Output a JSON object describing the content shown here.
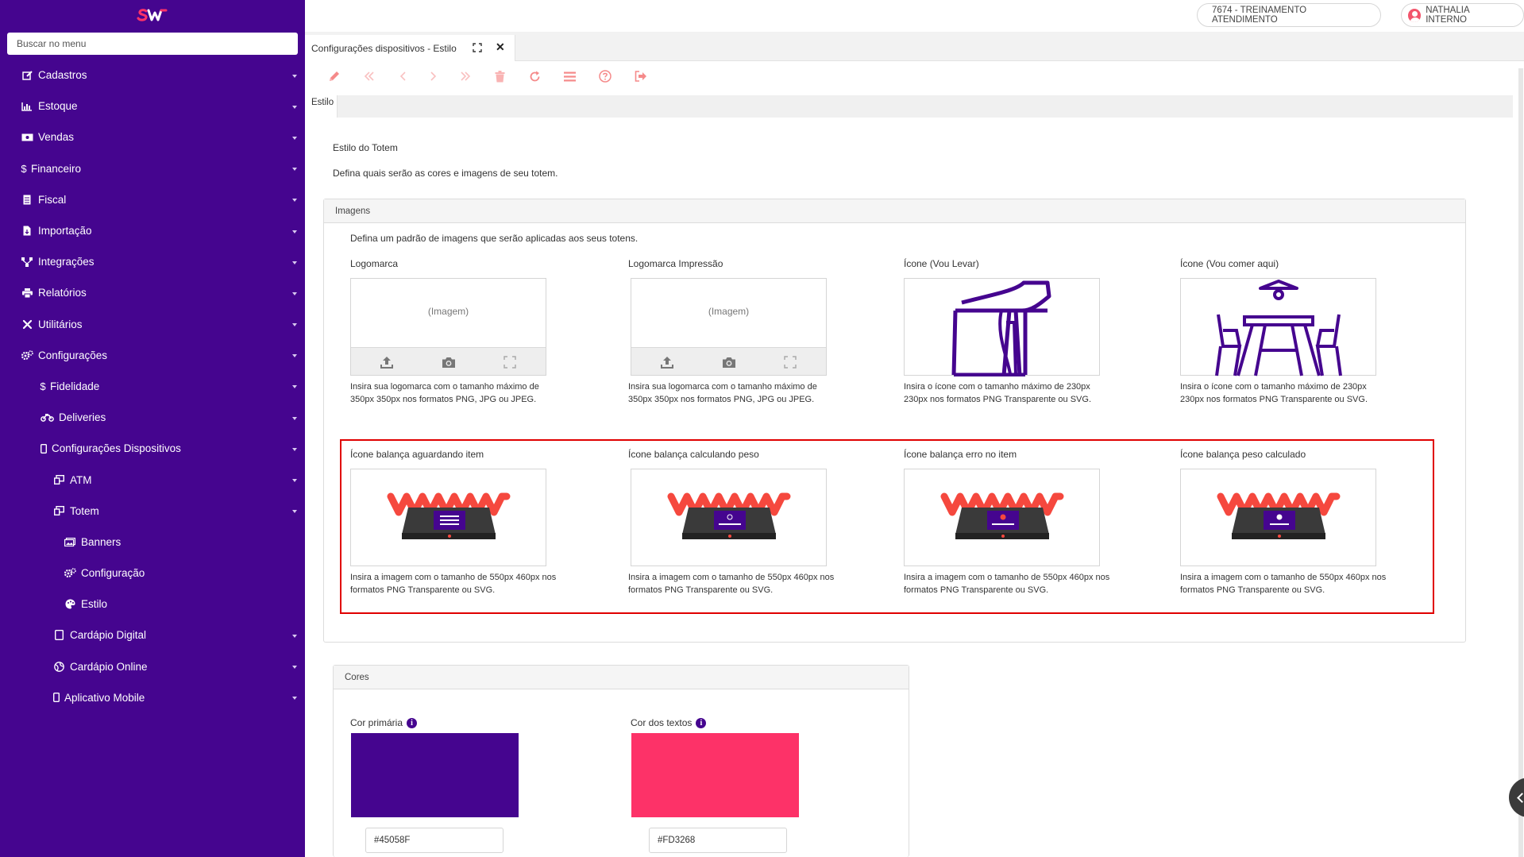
{
  "app": {
    "logo": "SW"
  },
  "sidebar": {
    "search_placeholder": "Buscar no menu",
    "items": [
      {
        "label": "Cadastros",
        "icon": "edit-icon"
      },
      {
        "label": "Estoque",
        "icon": "chart-icon"
      },
      {
        "label": "Vendas",
        "icon": "money-icon"
      },
      {
        "label": "Financeiro",
        "icon": "dollar-icon"
      },
      {
        "label": "Fiscal",
        "icon": "document-icon"
      },
      {
        "label": "Importação",
        "icon": "file-import-icon"
      },
      {
        "label": "Integrações",
        "icon": "network-icon"
      },
      {
        "label": "Relatórios",
        "icon": "print-icon"
      },
      {
        "label": "Utilitários",
        "icon": "tools-icon"
      },
      {
        "label": "Configurações",
        "icon": "cogs-icon"
      },
      {
        "label": "Fidelidade",
        "icon": "dollar-icon"
      },
      {
        "label": "Deliveries",
        "icon": "motorcycle-icon"
      },
      {
        "label": "Configurações Dispositivos",
        "icon": "mobile-icon"
      },
      {
        "label": "ATM",
        "icon": "desktop-icon"
      },
      {
        "label": "Totem",
        "icon": "desktop-icon"
      },
      {
        "label": "Banners",
        "icon": "images-icon"
      },
      {
        "label": "Configuração",
        "icon": "cogs-icon"
      },
      {
        "label": "Estilo",
        "icon": "palette-icon"
      },
      {
        "label": "Cardápio Digital",
        "icon": "tablet-icon"
      },
      {
        "label": "Cardápio Online",
        "icon": "globe-icon"
      },
      {
        "label": "Aplicativo Mobile",
        "icon": "mobile-icon"
      }
    ]
  },
  "header": {
    "company": "7674 - TREINAMENTO ATENDIMENTO",
    "user": "NATHALIA INTERNO"
  },
  "tab": {
    "label": "Configurações dispositivos - Estilo",
    "close": "✕"
  },
  "inner_tab": {
    "label": "Estilo"
  },
  "page": {
    "title": "Estilo do Totem",
    "description": "Defina quais serão as cores e imagens de seu totem."
  },
  "images_panel": {
    "title": "Imagens",
    "description": "Defina um padrão de imagens que serão aplicadas aos seus totens.",
    "placeholder": "(Imagem)",
    "fields": [
      {
        "label": "Logomarca",
        "help1": "Insira sua logomarca com o tamanho máximo de",
        "help2": "350px 350px nos formatos PNG, JPG ou JPEG."
      },
      {
        "label": "Logomarca Impressão",
        "help1": "Insira sua logomarca com o tamanho máximo de",
        "help2": "350px 350px nos formatos PNG, JPG ou JPEG."
      },
      {
        "label": "Ícone (Vou Levar)",
        "help1": "Insira o ícone com o tamanho máximo de 230px",
        "help2": "230px nos formatos PNG Transparente ou SVG."
      },
      {
        "label": "Ícone (Vou comer aqui)",
        "help1": "Insira o ícone com o tamanho máximo de 230px",
        "help2": "230px nos formatos PNG Transparente ou SVG."
      },
      {
        "label": "Ícone balança aguardando item",
        "help1": "Insira a imagem com o tamanho de 550px 460px nos",
        "help2": "formatos PNG Transparente ou SVG."
      },
      {
        "label": "Ícone balança calculando peso",
        "help1": "Insira a imagem com o tamanho de 550px 460px nos",
        "help2": "formatos PNG Transparente ou SVG."
      },
      {
        "label": "Ícone balança erro no item",
        "help1": "Insira a imagem com o tamanho de 550px 460px nos",
        "help2": "formatos PNG Transparente ou SVG."
      },
      {
        "label": "Ícone balança peso calculado",
        "help1": "Insira a imagem com o tamanho de 550px 460px nos",
        "help2": "formatos PNG Transparente ou SVG."
      }
    ]
  },
  "colors_panel": {
    "title": "Cores",
    "primary": {
      "label": "Cor primária",
      "value": "#45058F"
    },
    "text": {
      "label": "Cor dos textos",
      "value": "#FD3268"
    }
  },
  "theme": {
    "sidebar_bg": "#45058F",
    "accent": "#FD3268",
    "toolbar_icon": "#f58a8a",
    "highlight": "#e00000"
  }
}
